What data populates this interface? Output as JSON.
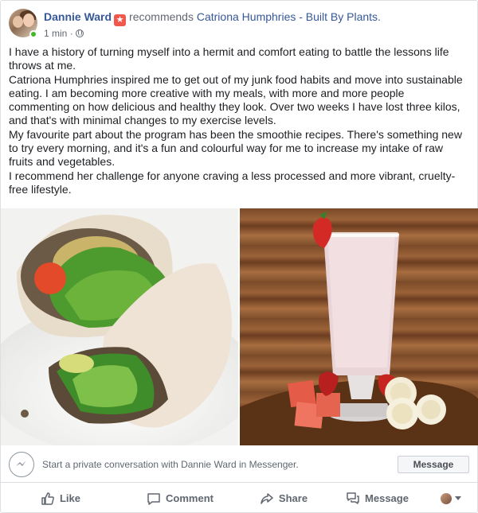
{
  "post": {
    "author": "Dannie Ward",
    "action_text": "recommends",
    "page_name": "Catriona Humphries - Built By Plants.",
    "timestamp": "1 min",
    "separator": "·",
    "paragraphs": [
      "I have a history of turning myself into a hermit and comfort eating to battle the lessons life throws at me.",
      "Catriona Humphries inspired me to get out of my junk food habits and move into sustainable eating. I am becoming more creative with my meals, with more and more people commenting on how delicious and healthy they look. Over two weeks I have lost three kilos, and that's with minimal changes to my exercise levels.",
      "My favourite part about the program has been the smoothie recipes. There's something new to try every morning, and it's a fun and colourful way for me to increase my intake of raw fruits and vegetables.",
      "I recommend her challenge for anyone craving a less processed and more vibrant, cruelty-free lifestyle."
    ],
    "icons": {
      "recommend": "recommend-star-icon",
      "privacy": "globe-icon"
    }
  },
  "photos": [
    {
      "name": "wrap-photo"
    },
    {
      "name": "smoothie-photo"
    }
  ],
  "messenger": {
    "prompt": "Start a private conversation with Dannie Ward in Messenger.",
    "button_label": "Message"
  },
  "actions": {
    "like": "Like",
    "comment": "Comment",
    "share": "Share",
    "message": "Message"
  },
  "colors": {
    "link": "#365899",
    "online": "#42b72a",
    "recommend_badge": "#f0584b",
    "muted": "#606770"
  }
}
